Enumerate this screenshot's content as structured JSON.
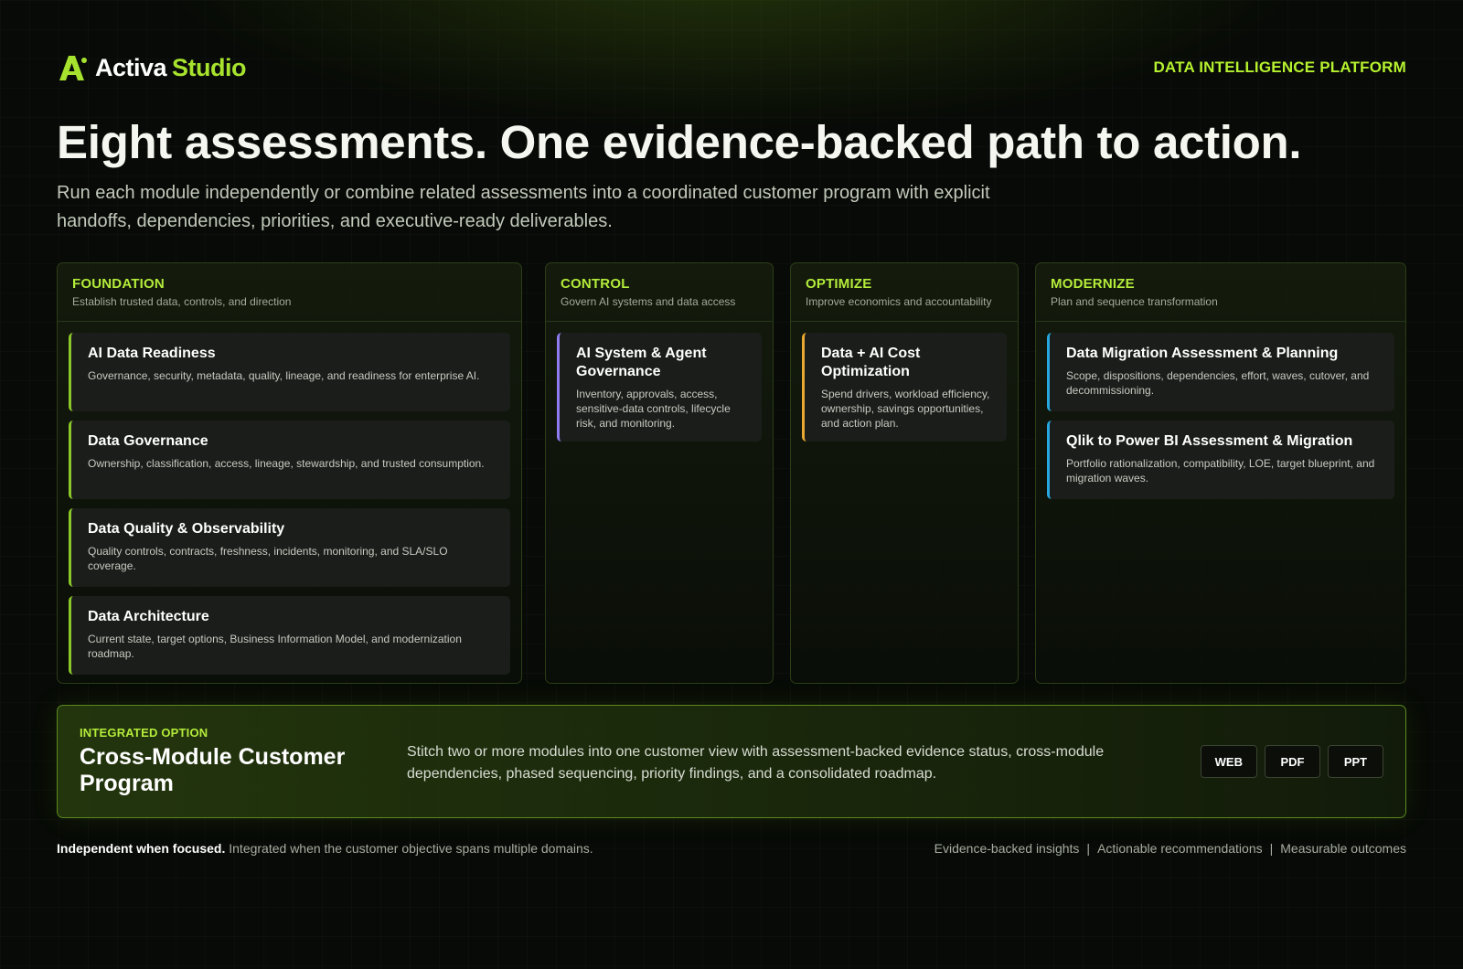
{
  "header": {
    "brand_primary": "Activa",
    "brand_secondary": "Studio",
    "tagline": "DATA INTELLIGENCE PLATFORM",
    "logo_icon": "activa-logo-icon",
    "accent_color": "#a6e22e"
  },
  "hero": {
    "title": "Eight assessments. One evidence-backed path to action.",
    "subtitle": "Run each module independently or combine related assessments into a coordinated customer program with explicit handoffs, dependencies, priorities, and executive-ready deliverables."
  },
  "columns": [
    {
      "title": "FOUNDATION",
      "subtitle": "Establish trusted data, controls, and direction",
      "cards": [
        {
          "title": "AI Data Readiness",
          "desc": "Governance, security, metadata, quality, lineage, and readiness for enterprise AI."
        },
        {
          "title": "Data Governance",
          "desc": "Ownership, classification, access, lineage, stewardship, and trusted consumption."
        },
        {
          "title": "Data Quality & Observability",
          "desc": "Quality controls, contracts, freshness, incidents, monitoring, and SLA/SLO coverage."
        },
        {
          "title": "Data Architecture",
          "desc": "Current state, target options, Business Information Model, and modernization roadmap."
        }
      ]
    },
    {
      "title": "CONTROL",
      "subtitle": "Govern AI systems and data access",
      "cards": [
        {
          "title": "AI System & Agent Governance",
          "desc": "Inventory, approvals, access, sensitive-data controls, lifecycle risk, and monitoring."
        }
      ]
    },
    {
      "title": "OPTIMIZE",
      "subtitle": "Improve economics and accountability",
      "cards": [
        {
          "title": "Data + AI Cost Optimization",
          "desc": "Spend drivers, workload efficiency, ownership, savings opportunities, and action plan."
        }
      ]
    },
    {
      "title": "MODERNIZE",
      "subtitle": "Plan and sequence transformation",
      "cards": [
        {
          "title": "Data Migration Assessment & Planning",
          "desc": "Scope, dispositions, dependencies, effort, waves, cutover, and decommissioning."
        },
        {
          "title": "Qlik to Power BI Assessment & Migration",
          "desc": "Portfolio rationalization, compatibility, LOE, target blueprint, and migration waves."
        }
      ]
    }
  ],
  "card_accents": {
    "foundation": "#8cc82a",
    "control": "#8e7cf0",
    "optimize": "#e8a832",
    "modernize": "#27a8e0"
  },
  "integrated": {
    "eyebrow": "INTEGRATED OPTION",
    "title": "Cross-Module Customer Program",
    "text": "Stitch two or more modules into one customer view with assessment-backed evidence status, cross-module dependencies, phased sequencing, priority findings, and a consolidated roadmap.",
    "buttons": [
      "WEB",
      "PDF",
      "PPT"
    ]
  },
  "footer": {
    "left_bold": "Independent when focused.",
    "left_text": "Integrated when the customer objective spans multiple domains.",
    "right_items": [
      "Evidence-backed insights",
      "Actionable recommendations",
      "Measurable outcomes"
    ],
    "separator": "|"
  }
}
